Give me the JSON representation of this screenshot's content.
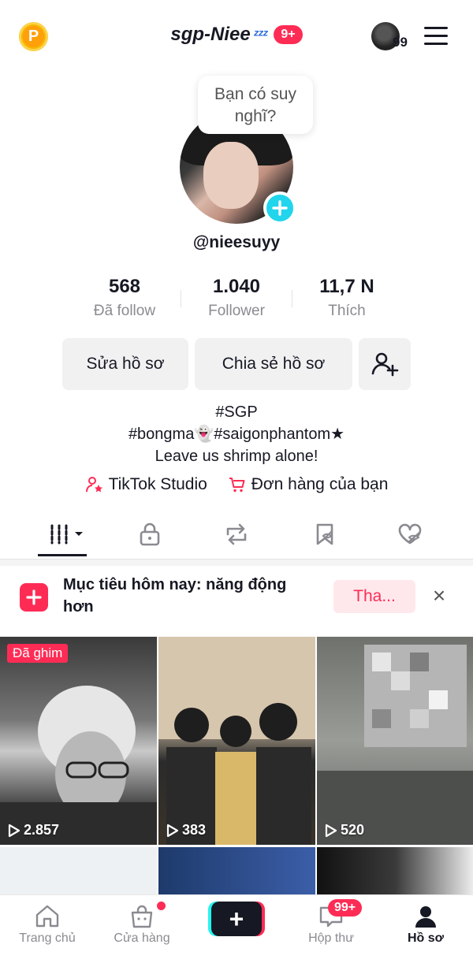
{
  "header": {
    "username": "sgp-Niee",
    "status_emoji": "ᶻᶻᶻ",
    "notification_badge": "9+",
    "follower_avatar_count": "99",
    "coin_letter": "P"
  },
  "profile": {
    "thought_bubble": "Bạn có suy nghĩ?",
    "handle": "@nieesuyy",
    "add_icon": "plus-icon"
  },
  "stats": [
    {
      "value": "568",
      "label": "Đã follow"
    },
    {
      "value": "1.040",
      "label": "Follower"
    },
    {
      "value": "11,7 N",
      "label": "Thích"
    }
  ],
  "actions": {
    "edit_profile": "Sửa hồ sơ",
    "share_profile": "Chia sẻ hồ sơ"
  },
  "bio": {
    "line1": "#SGP",
    "line2": "#bongma👻#saigonphantom★",
    "line3": "Leave us shrimp alone!"
  },
  "links": {
    "studio": "TikTok Studio",
    "orders": "Đơn hàng của bạn"
  },
  "goal": {
    "text": "Mục tiêu hôm nay: năng động hơn",
    "join_label": "Tha...",
    "close": "×"
  },
  "videos": [
    {
      "views": "2.857",
      "pinned_label": "Đã ghim"
    },
    {
      "views": "383"
    },
    {
      "views": "520"
    }
  ],
  "bottom_nav": {
    "home": "Trang chủ",
    "shop": "Cửa hàng",
    "create": "+",
    "inbox": "Hộp thư",
    "inbox_badge": "99+",
    "profile": "Hồ sơ"
  },
  "colors": {
    "accent": "#fe2c55",
    "cyan": "#20d5ec"
  }
}
